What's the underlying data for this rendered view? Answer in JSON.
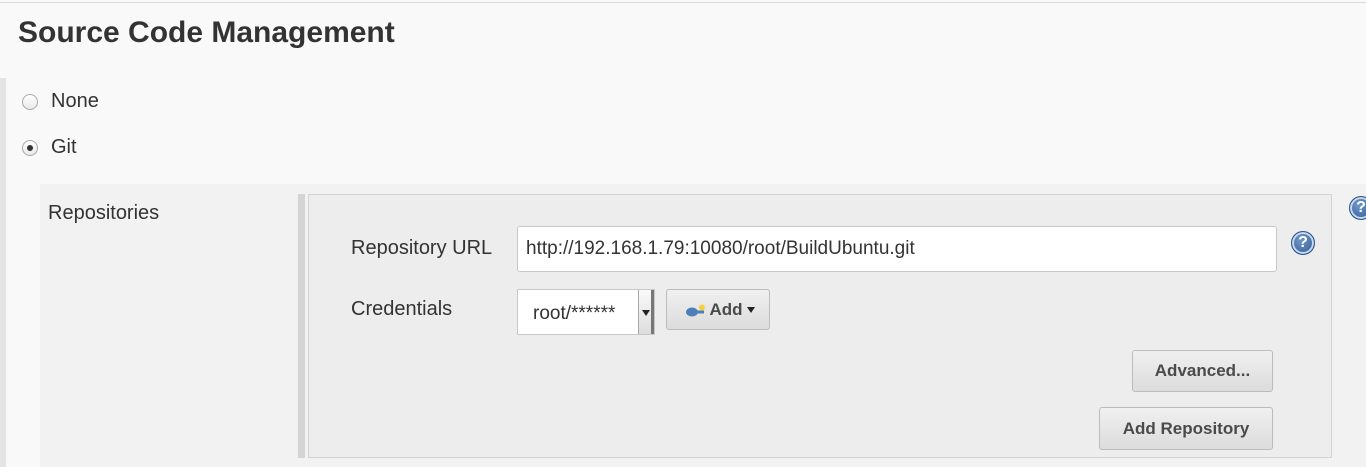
{
  "section": {
    "title": "Source Code Management"
  },
  "scm_options": [
    {
      "label": "None",
      "checked": false
    },
    {
      "label": "Git",
      "checked": true
    }
  ],
  "git": {
    "repositories_label": "Repositories",
    "repository_url": {
      "label": "Repository URL",
      "value": "http://192.168.1.79:10080/root/BuildUbuntu.git"
    },
    "credentials": {
      "label": "Credentials",
      "selected": "root/******",
      "add_label": "Add"
    },
    "advanced_label": "Advanced...",
    "add_repository_label": "Add Repository"
  },
  "icons": {
    "help": "help-icon",
    "key": "key-icon",
    "dropdown": "chevron-down-icon"
  },
  "colors": {
    "page_bg": "#f9f9f9",
    "panel_bg": "#ededed",
    "help_blue": "#2c5a94",
    "text": "#333333"
  }
}
